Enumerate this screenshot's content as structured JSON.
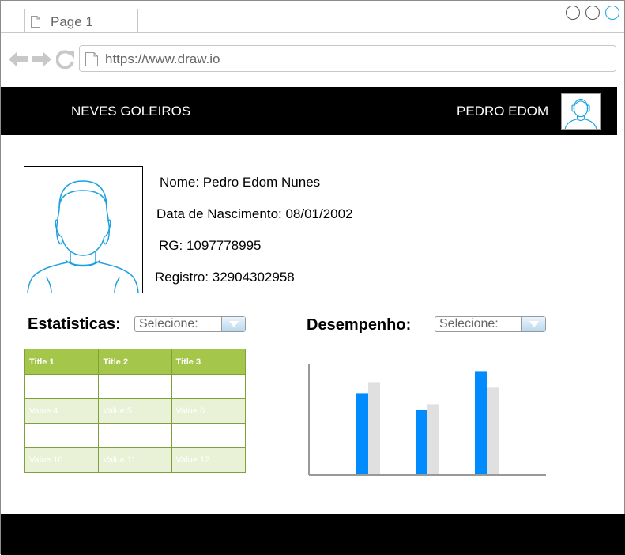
{
  "browser": {
    "tab_label": "Page 1",
    "url": "https://www.draw.io"
  },
  "header": {
    "brand": "NEVES GOLEIROS",
    "user_name": "PEDRO EDOM"
  },
  "profile": {
    "name": "Nome: Pedro Edom Nunes",
    "birth_date": "Data de Nascimento: 08/01/2002",
    "rg": "RG: 1097778995",
    "registro": "Registro: 32904302958"
  },
  "estatisticas": {
    "title": "Estatisticas:",
    "select_value": "Selecione:",
    "columns": [
      "Title 1",
      "Title 2",
      "Title 3"
    ],
    "rows": [
      [
        "",
        "",
        ""
      ],
      [
        "Value 4",
        "Value 5",
        "Value 6"
      ],
      [
        "",
        "",
        ""
      ],
      [
        "Value 10",
        "Value 11",
        "Value 12"
      ]
    ]
  },
  "desempenho": {
    "title": "Desempenho:",
    "select_value": "Selecione:"
  },
  "chart_data": {
    "type": "bar",
    "categories": [
      "",
      "",
      ""
    ],
    "series": [
      {
        "values": [
          74,
          59,
          94
        ]
      },
      {
        "values": [
          84,
          64,
          79
        ]
      }
    ],
    "colors": [
      "#008cff",
      "#e0e0e0"
    ],
    "ylim": [
      0,
      100
    ],
    "title": "",
    "xlabel": "",
    "ylabel": ""
  }
}
